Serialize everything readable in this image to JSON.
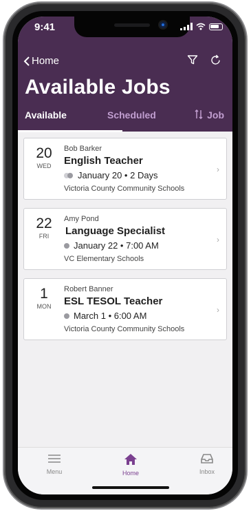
{
  "status_bar": {
    "time": "9:41"
  },
  "header": {
    "back_label": "Home",
    "title": "Available Jobs",
    "icons": {
      "filter": "filter-icon",
      "refresh": "refresh-icon"
    }
  },
  "tabs": {
    "available": "Available",
    "scheduled": "Scheduled",
    "sort": "Job"
  },
  "jobs": [
    {
      "day": "20",
      "dow": "WED",
      "person": "Bob Barker",
      "title": "English Teacher",
      "when": "January 20 • 2 Days",
      "school": "Victoria County Community Schools",
      "multi_day": true
    },
    {
      "day": "22",
      "dow": "FRI",
      "person": "Amy Pond",
      "title": "Language Specialist",
      "when": "January 22 • 7:00 AM",
      "school": "VC Elementary Schools",
      "multi_day": false
    },
    {
      "day": "1",
      "dow": "MON",
      "person": "Robert Banner",
      "title": "ESL TESOL Teacher",
      "when": "March 1 • 6:00 AM",
      "school": "Victoria County Community Schools",
      "multi_day": false
    }
  ],
  "tabbar": {
    "menu": "Menu",
    "home": "Home",
    "inbox": "Inbox"
  },
  "colors": {
    "header": "#4a2d52",
    "accent": "#7a3f8f",
    "inactive_tab": "#c19ed0"
  }
}
